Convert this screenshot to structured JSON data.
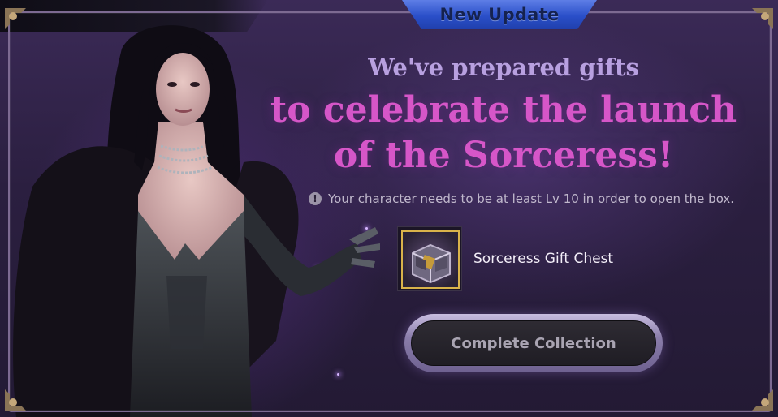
{
  "tab": {
    "label": "New Update"
  },
  "headline": {
    "line1": "We've prepared gifts",
    "line2": "to celebrate the launch",
    "line3": "of the Sorceress!"
  },
  "notice": {
    "icon": "exclamation-icon",
    "text": "Your character needs to be at least Lv 10 in order to open the box."
  },
  "reward": {
    "icon": "gift-chest-icon",
    "name": "Sorceress Gift Chest"
  },
  "button": {
    "label": "Complete Collection",
    "state": "disabled"
  },
  "colors": {
    "accent_pink": "#d656c8",
    "headline_lavender": "#b8a0e0",
    "tab_blue": "#2a4fc9",
    "item_border_gold": "#d9b34a"
  }
}
